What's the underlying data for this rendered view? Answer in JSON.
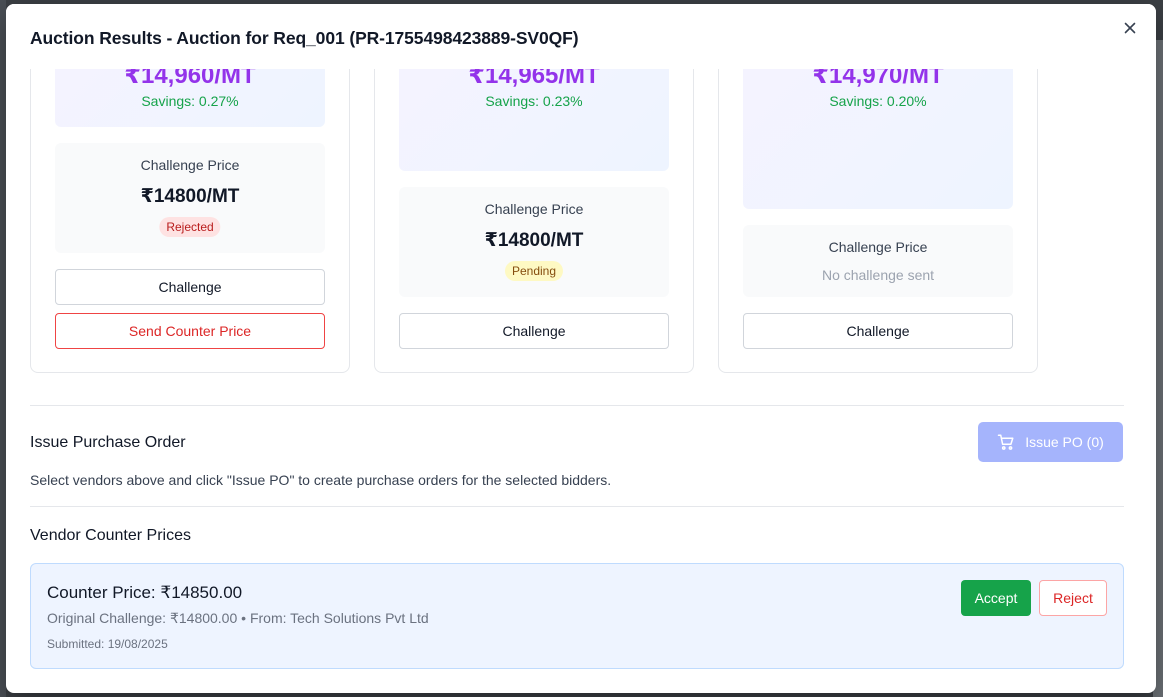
{
  "modal": {
    "title": "Auction Results - Auction for Req_001 (PR-1755498423889-SV0QF)"
  },
  "vendors": [
    {
      "price": "₹14,960/MT",
      "savings": "Savings: 0.27%",
      "challenge_label": "Challenge Price",
      "challenge_value": "₹14800/MT",
      "status": "Rejected",
      "challenge_button": "Challenge",
      "counter_button": "Send Counter Price"
    },
    {
      "price": "₹14,965/MT",
      "savings": "Savings: 0.23%",
      "challenge_label": "Challenge Price",
      "challenge_value": "₹14800/MT",
      "status": "Pending",
      "challenge_button": "Challenge"
    },
    {
      "price": "₹14,970/MT",
      "savings": "Savings: 0.20%",
      "challenge_label": "Challenge Price",
      "challenge_none": "No challenge sent",
      "challenge_button": "Challenge"
    }
  ],
  "purchase_order": {
    "title": "Issue Purchase Order",
    "button_label": "Issue PO (0)",
    "help_text": "Select vendors above and click \"Issue PO\" to create purchase orders for the selected bidders."
  },
  "counter_prices": {
    "title": "Vendor Counter Prices",
    "items": [
      {
        "price": "Counter Price: ₹14850.00",
        "original": "Original Challenge: ₹14800.00 • From: Tech Solutions Pvt Ltd",
        "submitted": "Submitted: 19/08/2025",
        "accept_label": "Accept",
        "reject_label": "Reject"
      }
    ]
  },
  "colors": {
    "price_purple": "#9333ea",
    "savings_green": "#16a34a",
    "accept_green": "#16a34a",
    "danger_red": "#dc2626",
    "issue_po_disabled": "#a5b4fc"
  }
}
